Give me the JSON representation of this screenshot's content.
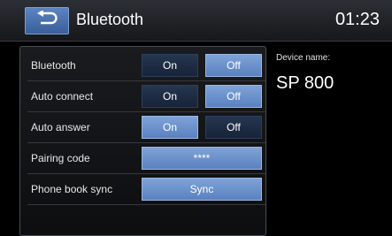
{
  "header": {
    "title": "Bluetooth",
    "time": "01:23"
  },
  "settings": [
    {
      "label": "Bluetooth",
      "on": "On",
      "off": "Off"
    },
    {
      "label": "Auto connect",
      "on": "On",
      "off": "Off"
    },
    {
      "label": "Auto answer",
      "on": "On",
      "off": "Off"
    }
  ],
  "pairing": {
    "label": "Pairing code",
    "value": "****"
  },
  "phonebook": {
    "label": "Phone book sync",
    "button": "Sync"
  },
  "device": {
    "label": "Device name:",
    "name": "SP 800"
  }
}
